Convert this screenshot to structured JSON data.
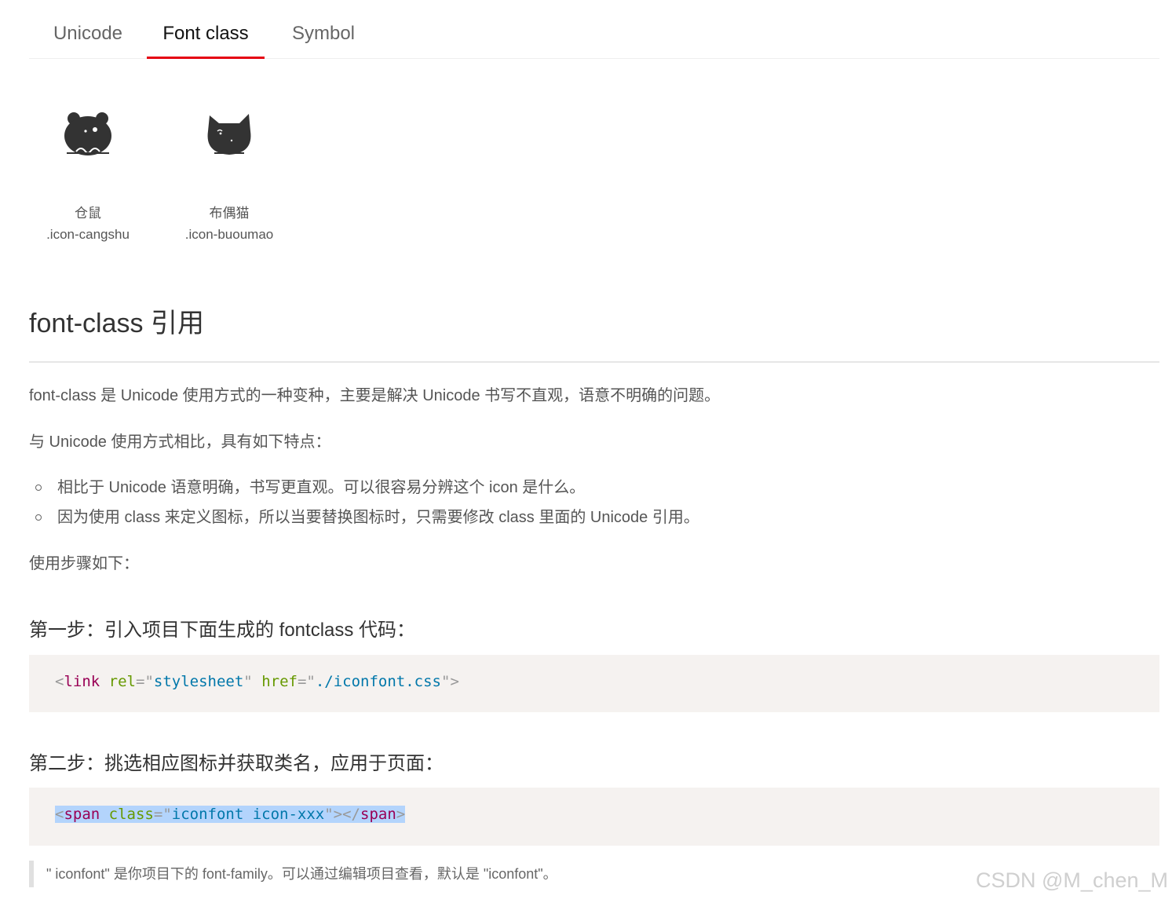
{
  "tabs": [
    {
      "label": "Unicode"
    },
    {
      "label": "Font class"
    },
    {
      "label": "Symbol"
    }
  ],
  "icons": [
    {
      "name": "仓鼠",
      "class_name": ".icon-cangshu",
      "icon": "hamster-icon"
    },
    {
      "name": "布偶猫",
      "class_name": ".icon-buoumao",
      "icon": "ragdoll-cat-icon"
    }
  ],
  "section": {
    "title": "font-class 引用",
    "intro": "font-class 是 Unicode 使用方式的一种变种，主要是解决 Unicode 书写不直观，语意不明确的问题。",
    "compare": "与 Unicode 使用方式相比，具有如下特点：",
    "features": [
      "相比于 Unicode 语意明确，书写更直观。可以很容易分辨这个 icon 是什么。",
      "因为使用 class 来定义图标，所以当要替换图标时，只需要修改 class 里面的 Unicode 引用。"
    ],
    "steps_intro": "使用步骤如下：",
    "step1_title": "第一步：引入项目下面生成的 fontclass 代码：",
    "step2_title": "第二步：挑选相应图标并获取类名，应用于页面：",
    "note": "\" iconfont\" 是你项目下的 font-family。可以通过编辑项目查看，默认是 \"iconfont\"。"
  },
  "code1": {
    "open": "<",
    "tag": "link",
    "attr1": "rel",
    "eq1": "=\"",
    "val1": "stylesheet",
    "q1": "\"",
    "attr2": "href",
    "eq2": "=\"",
    "val2": "./iconfont.css",
    "close": "\">"
  },
  "code2": {
    "open": "<",
    "tag": "span",
    "attr": "class",
    "eq": "=\"",
    "val": "iconfont icon-xxx",
    "mid": "\"></",
    "tag_close": "span",
    "end": ">"
  },
  "watermark": "CSDN @M_chen_M",
  "colors": {
    "accent": "#e50012",
    "code_bg": "#f5f2f0",
    "selection": "#b3d4fc"
  }
}
